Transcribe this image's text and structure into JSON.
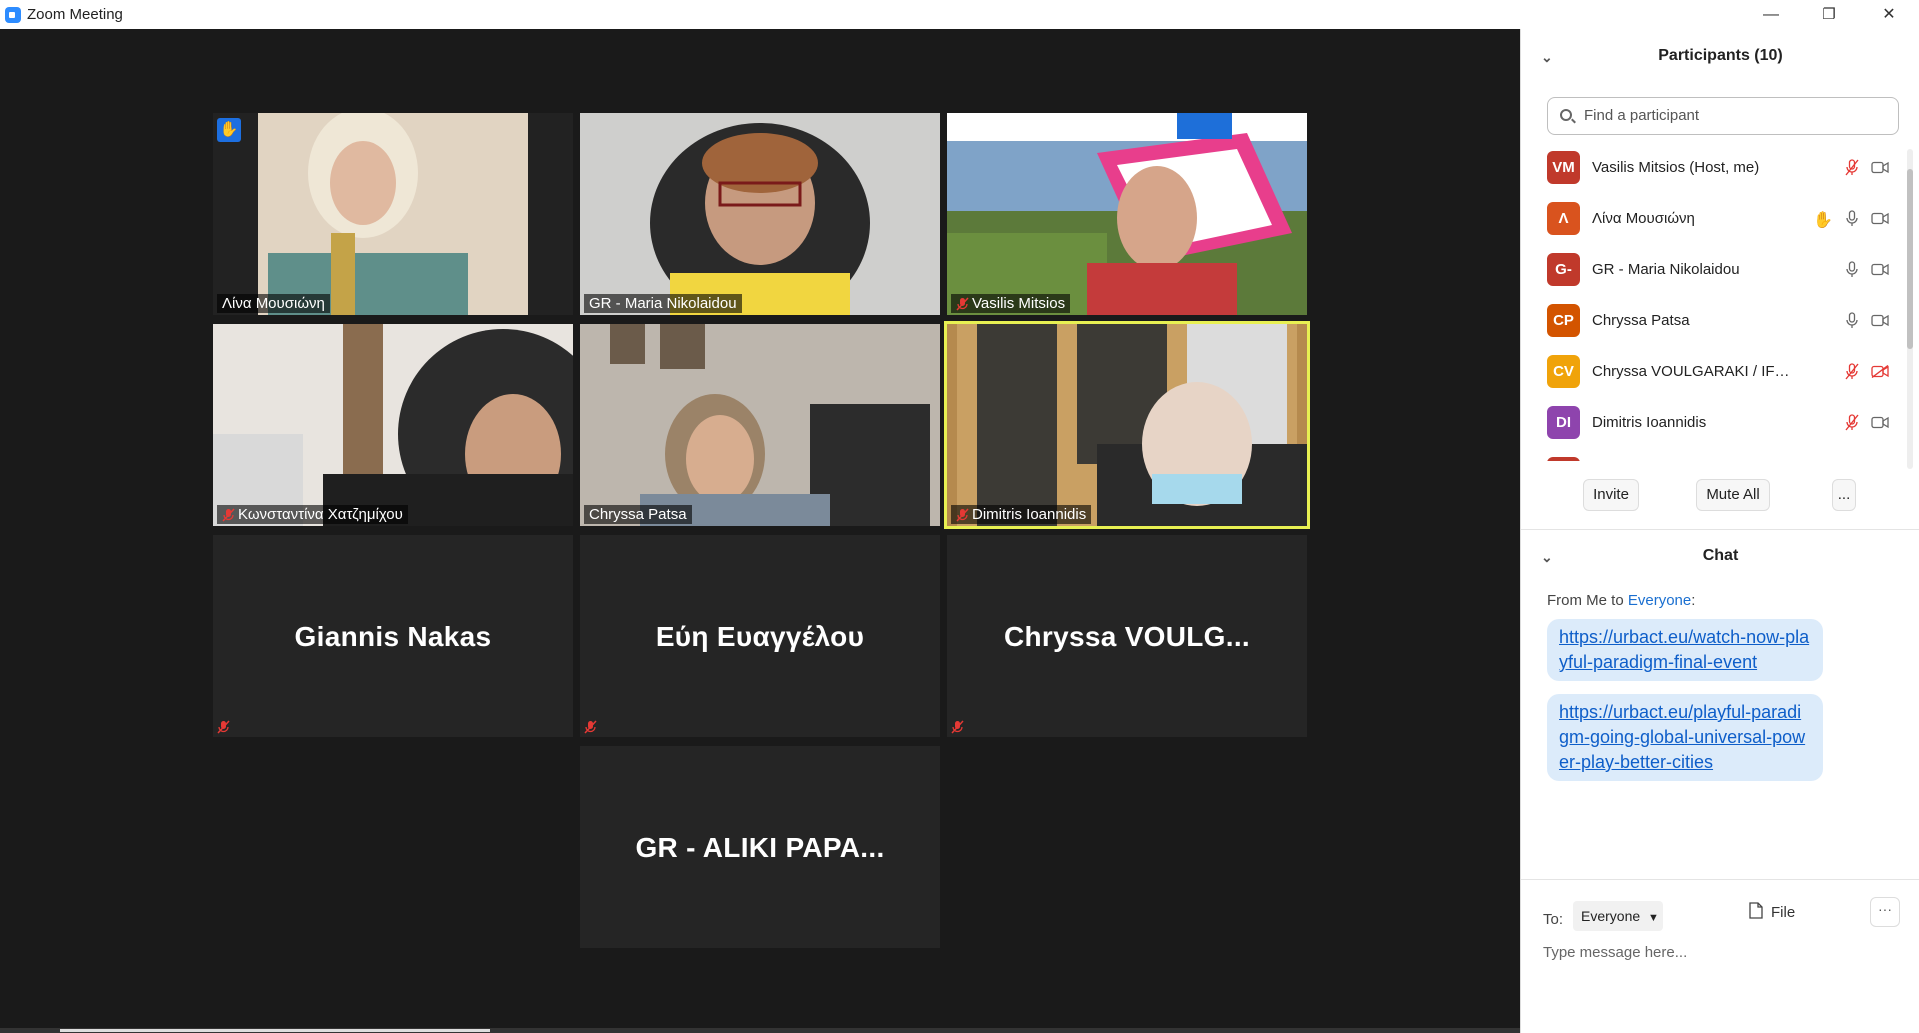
{
  "window": {
    "title": "Zoom Meeting",
    "minimize_glyph": "—",
    "restore_glyph": "❐",
    "close_glyph": "✕"
  },
  "gallery": {
    "tiles": [
      {
        "name": "Λίνα Μουσιώνη",
        "video": true,
        "muted": false,
        "hand_raised": true
      },
      {
        "name": "GR - Maria Nikolaidou",
        "video": true,
        "muted": false
      },
      {
        "name": "Vasilis Mitsios",
        "video": true,
        "muted": true
      },
      {
        "name": "Κωνσταντίνα Χατζημίχου",
        "video": true,
        "muted": true
      },
      {
        "name": "Chryssa Patsa",
        "video": true,
        "muted": false
      },
      {
        "name": "Dimitris Ioannidis",
        "video": true,
        "muted": true,
        "speaking": true
      },
      {
        "name": "Giannis Nakas",
        "video": false,
        "muted": true
      },
      {
        "name": "Εύη Ευαγγέλου",
        "video": false,
        "muted": true
      },
      {
        "name": "Chryssa  VOULG...",
        "video": false,
        "muted": true
      },
      {
        "name": "GR - ALIKI PAPA...",
        "video": false,
        "muted": false
      }
    ]
  },
  "participants": {
    "header": "Participants (10)",
    "search_placeholder": "Find a participant",
    "list": [
      {
        "initials": "VM",
        "color": "#c0392b",
        "name": "Vasilis Mitsios (Host, me)",
        "mic": "muted",
        "cam": "on"
      },
      {
        "initials": "Λ",
        "color": "#d9531e",
        "name": "Λίνα Μουσιώνη",
        "mic": "on",
        "cam": "on",
        "hand": true
      },
      {
        "initials": "G-",
        "color": "#c0392b",
        "name": "GR - Maria Nikolaidou",
        "mic": "on",
        "cam": "on"
      },
      {
        "initials": "CP",
        "color": "#d35400",
        "name": "Chryssa Patsa",
        "mic": "on",
        "cam": "on"
      },
      {
        "initials": "CV",
        "color": "#f0a30a",
        "name": "Chryssa VOULGARAKI / IFGreceL...",
        "mic": "muted",
        "cam": "off"
      },
      {
        "initials": "DI",
        "color": "#8e44ad",
        "name": "Dimitris Ioannidis",
        "mic": "muted",
        "cam": "on"
      }
    ],
    "invite_label": "Invite",
    "mute_all_label": "Mute All",
    "more_label": "..."
  },
  "chat": {
    "header": "Chat",
    "from_prefix": "From Me to ",
    "from_target": "Everyone",
    "from_suffix": ":",
    "messages": [
      "https://urbact.eu/watch-now-playful-paradigm-final-event",
      "https://urbact.eu/playful-paradigm-going-global-universal-power-play-better-cities"
    ],
    "to_label": "To:",
    "to_value": "Everyone",
    "file_label": "File",
    "more_label": "···",
    "input_placeholder": "Type message here..."
  }
}
